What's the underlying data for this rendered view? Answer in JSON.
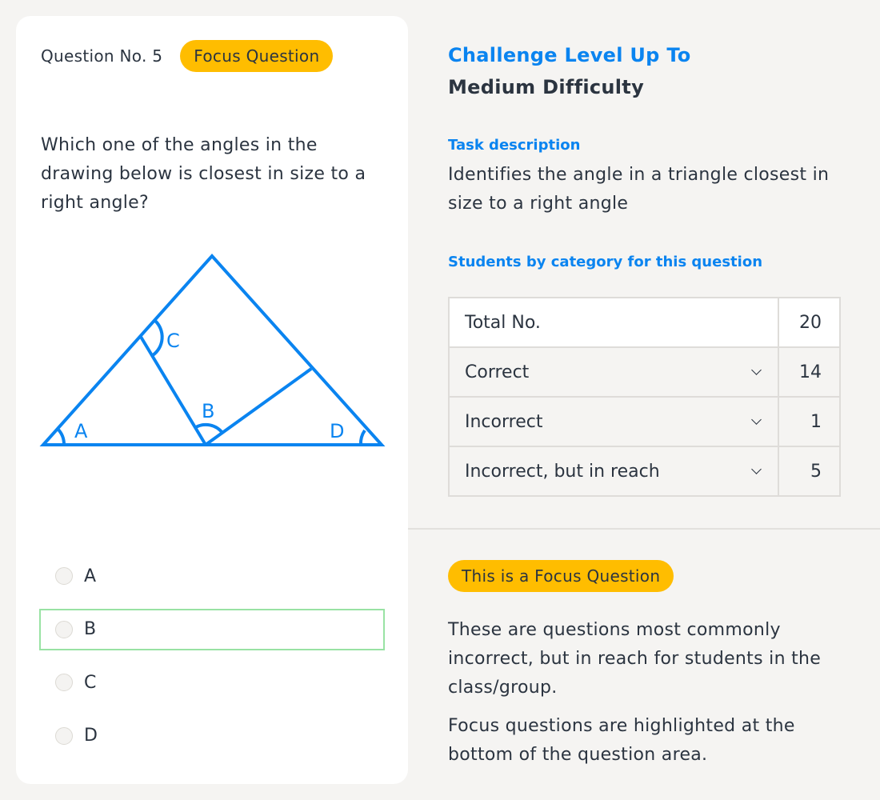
{
  "question": {
    "number_label": "Question No. 5",
    "badge": "Focus Question",
    "text": "Which one of the angles in the drawing below is closest in size to a right angle?",
    "diagram_labels": [
      "A",
      "B",
      "C",
      "D"
    ],
    "options": [
      {
        "label": "A",
        "highlighted": false
      },
      {
        "label": "B",
        "highlighted": true
      },
      {
        "label": "C",
        "highlighted": false
      },
      {
        "label": "D",
        "highlighted": false
      }
    ]
  },
  "info": {
    "challenge_title": "Challenge Level Up To",
    "difficulty": "Medium Difficulty",
    "task_label": "Task description",
    "task_description": "Identifies the angle in a triangle closest in size to a right angle",
    "students_label": "Students by category for this question",
    "stats": {
      "total": {
        "label": "Total No.",
        "value": "20"
      },
      "categories": [
        {
          "label": "Correct",
          "value": "14",
          "icon": "chevron-down-icon"
        },
        {
          "label": "Incorrect",
          "value": "1",
          "icon": "chevron-down-icon"
        },
        {
          "label": "Incorrect, but in reach",
          "value": "5",
          "icon": "chevron-down-icon"
        }
      ]
    },
    "focus_badge": "This is a Focus Question",
    "focus_description_1": "These are questions most commonly incorrect, but in reach for students in the class/group.",
    "focus_description_2": "Focus questions are highlighted at the bottom of the question area."
  },
  "colors": {
    "accent_blue": "#0a84f0",
    "badge_yellow": "#ffbd00",
    "correct_highlight": "#99e2a4",
    "text_dark": "#2b3440"
  }
}
